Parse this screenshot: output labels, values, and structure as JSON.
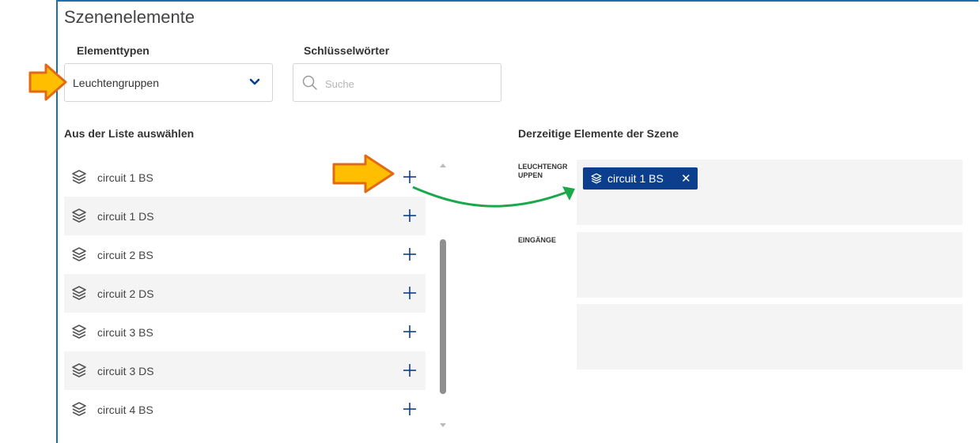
{
  "title": "Szenenelemente",
  "filters": {
    "type_label": "Elementtypen",
    "keywords_label": "Schlüsselwörter",
    "type_value": "Leuchtengruppen",
    "search_placeholder": "Suche"
  },
  "list": {
    "header": "Aus der Liste auswählen",
    "items": [
      {
        "name": "circuit 1 BS"
      },
      {
        "name": "circuit 1 DS"
      },
      {
        "name": "circuit 2 BS"
      },
      {
        "name": "circuit 2 DS"
      },
      {
        "name": "circuit 3 BS"
      },
      {
        "name": "circuit 3 DS"
      },
      {
        "name": "circuit 4 BS"
      }
    ]
  },
  "current": {
    "header": "Derzeitige Elemente der Szene",
    "groups": [
      {
        "label_line1": "LEUCHTENGR",
        "label_line2": "UPPEN",
        "chips": [
          "circuit 1 BS"
        ]
      },
      {
        "label_line1": "EINGÄNGE",
        "label_line2": "",
        "chips": []
      },
      {
        "label_line1": "",
        "label_line2": "",
        "chips": []
      }
    ]
  },
  "colors": {
    "accent": "#0c3e8e",
    "border": "#1e6fb0",
    "annotation_arrow": "#ffbe00",
    "annotation_line": "#19a84a"
  },
  "icons": {
    "list_item": "layers-icon",
    "add": "plus-icon",
    "remove": "close-icon",
    "dropdown": "chevron-down-icon",
    "search": "search-icon"
  }
}
